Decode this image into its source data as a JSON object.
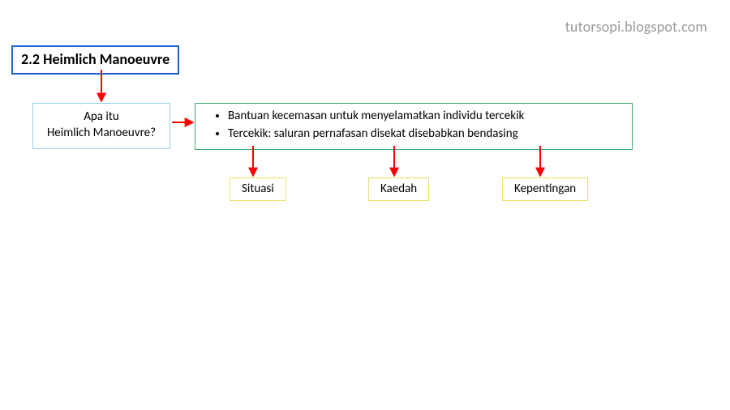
{
  "watermark": "tutorsopi.blogspot.com",
  "title": "2.2  Heimlich Manoeuvre",
  "question": {
    "line1": "Apa itu",
    "line2": "Heimlich Manoeuvre?"
  },
  "info": {
    "bullet1": "Bantuan kecemasan untuk menyelamatkan individu tercekik",
    "bullet2": "Tercekik: saluran pernafasan disekat disebabkan bendasing"
  },
  "children": {
    "situasi": "Situasi",
    "kaedah": "Kaedah",
    "kepentingan": "Kepentingan"
  },
  "colors": {
    "arrow": "#ff0000",
    "title_border": "#1e5fd6",
    "question_border": "#8fd3f0",
    "info_border": "#3fae6f",
    "child_border": "#e8e36a"
  }
}
